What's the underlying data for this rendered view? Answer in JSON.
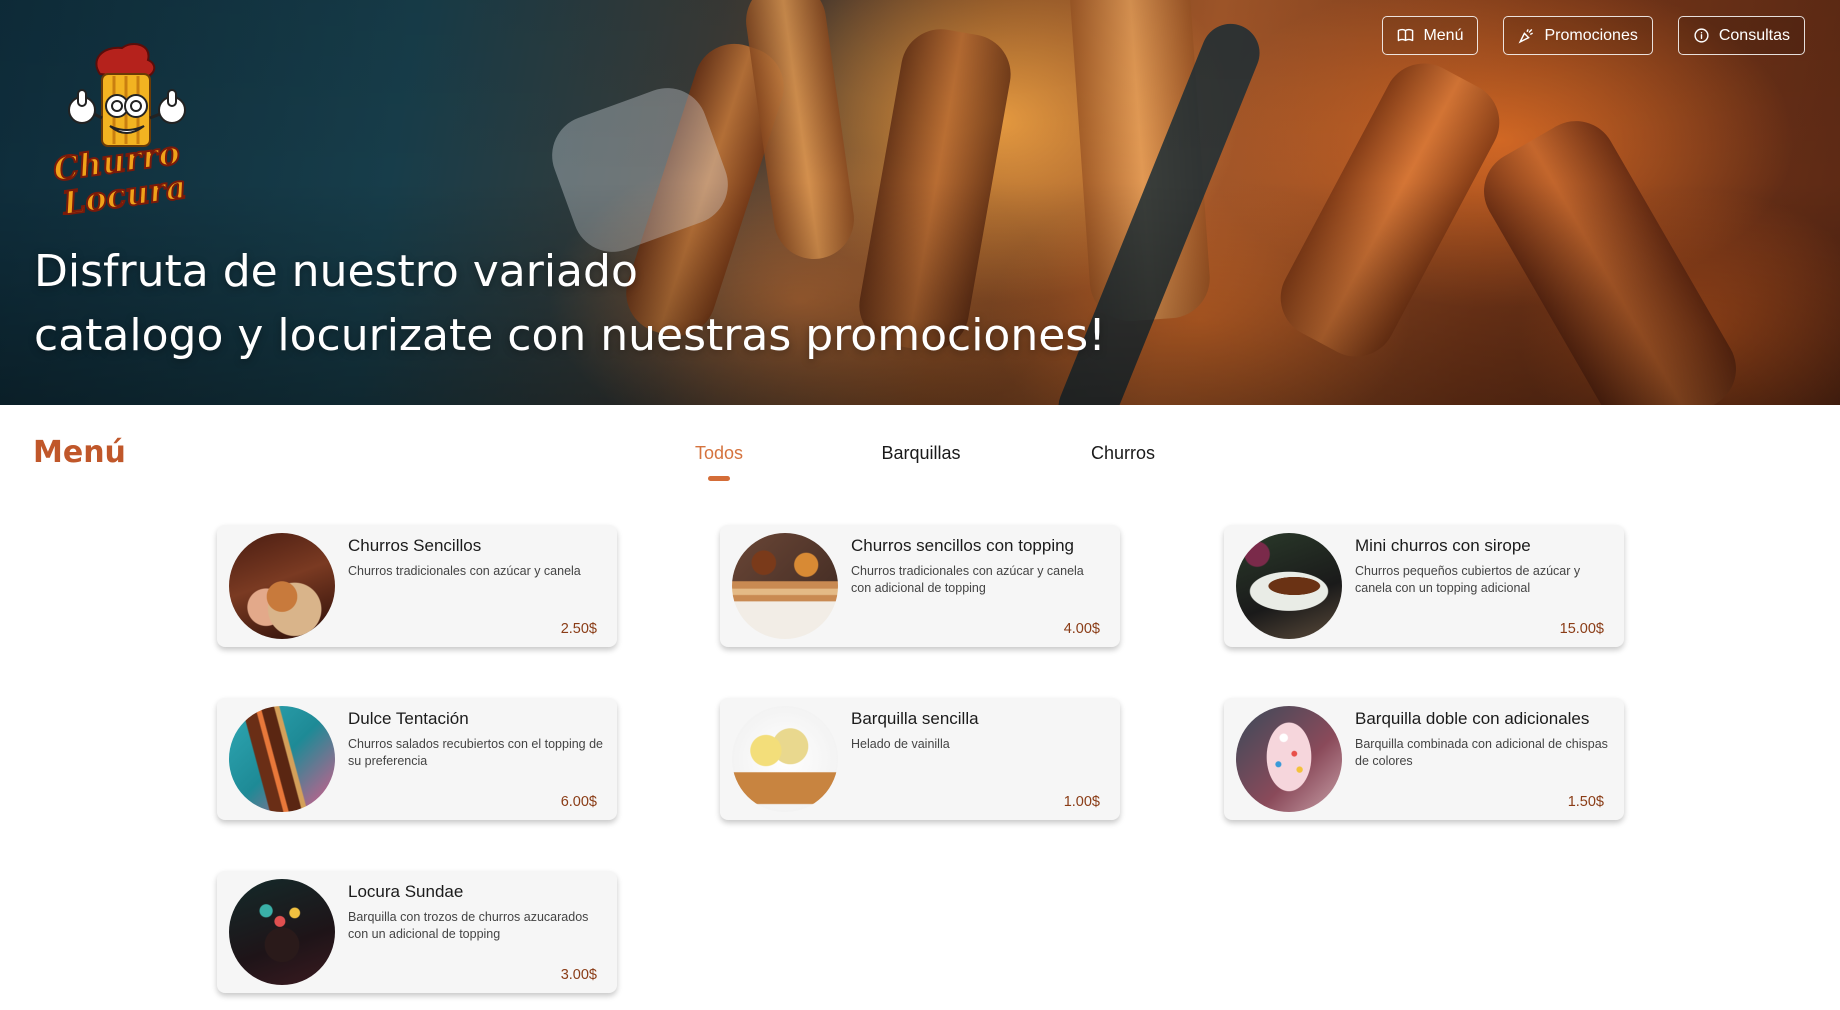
{
  "brand": {
    "logo_text_line1": "Churro",
    "logo_text_line2": "Locura"
  },
  "nav": {
    "items": [
      {
        "label": "Menú",
        "icon": "book-icon"
      },
      {
        "label": "Promociones",
        "icon": "party-popper-icon"
      },
      {
        "label": "Consultas",
        "icon": "info-circle-icon"
      }
    ]
  },
  "hero": {
    "title_line1": "Disfruta de nuestro variado",
    "title_line2": "catalogo y locurizate con nuestras promociones!"
  },
  "menu": {
    "title": "Menú",
    "tabs": [
      {
        "label": "Todos",
        "active": true
      },
      {
        "label": "Barquillas",
        "active": false
      },
      {
        "label": "Churros",
        "active": false
      }
    ],
    "items": [
      {
        "name": "Churros Sencillos",
        "description": "Churros tradicionales con azúcar y canela",
        "price": "2.50$",
        "image": "churros-cone-photo"
      },
      {
        "name": "Churros sencillos con topping",
        "description": "Churros tradicionales con azúcar y canela con adicional de topping",
        "price": "4.00$",
        "image": "churros-tray-with-dips-photo"
      },
      {
        "name": "Mini churros con sirope",
        "description": "Churros pequeños cubiertos de azúcar y canela con un topping adicional",
        "price": "15.00$",
        "image": "mini-churros-plate-photo"
      },
      {
        "name": "Dulce Tentación",
        "description": "Churros salados recubiertos con el topping de su preferencia",
        "price": "6.00$",
        "image": "sprinkled-churros-photo"
      },
      {
        "name": "Barquilla sencilla",
        "description": "Helado de vainilla",
        "price": "1.00$",
        "image": "ice-cream-cone-photo"
      },
      {
        "name": "Barquilla doble con adicionales",
        "description": "Barquilla combinada con adicional de chispas de colores",
        "price": "1.50$",
        "image": "sprinkles-cone-photo"
      },
      {
        "name": "Locura Sundae",
        "description": "Barquilla con trozos de churros azucarados con un adicional de topping",
        "price": "3.00$",
        "image": "sundae-dark-photo"
      }
    ]
  },
  "colors": {
    "accent": "#c0572a",
    "tab_active": "#d5733e",
    "price": "#8a3c16",
    "card_bg": "#f6f6f6"
  }
}
